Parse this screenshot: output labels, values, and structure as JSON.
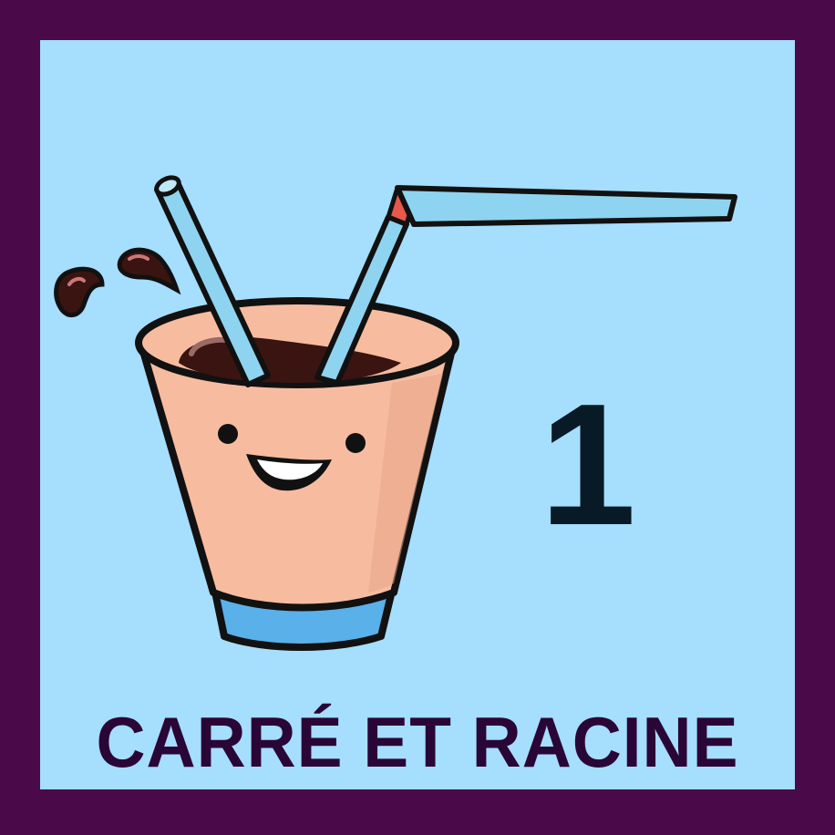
{
  "card": {
    "number": "1",
    "title": "CARRÉ ET RACINE"
  },
  "illustration": {
    "icon": "smiling-cup-with-straws-icon"
  },
  "colors": {
    "frame": "#4a0a4a",
    "background": "#a6defe",
    "cup": "#f7bca0",
    "cup_base": "#5ab0e8",
    "straw": "#8ed4f0",
    "drink": "#3a1410",
    "number": "#081a26",
    "title": "#2a0636"
  }
}
